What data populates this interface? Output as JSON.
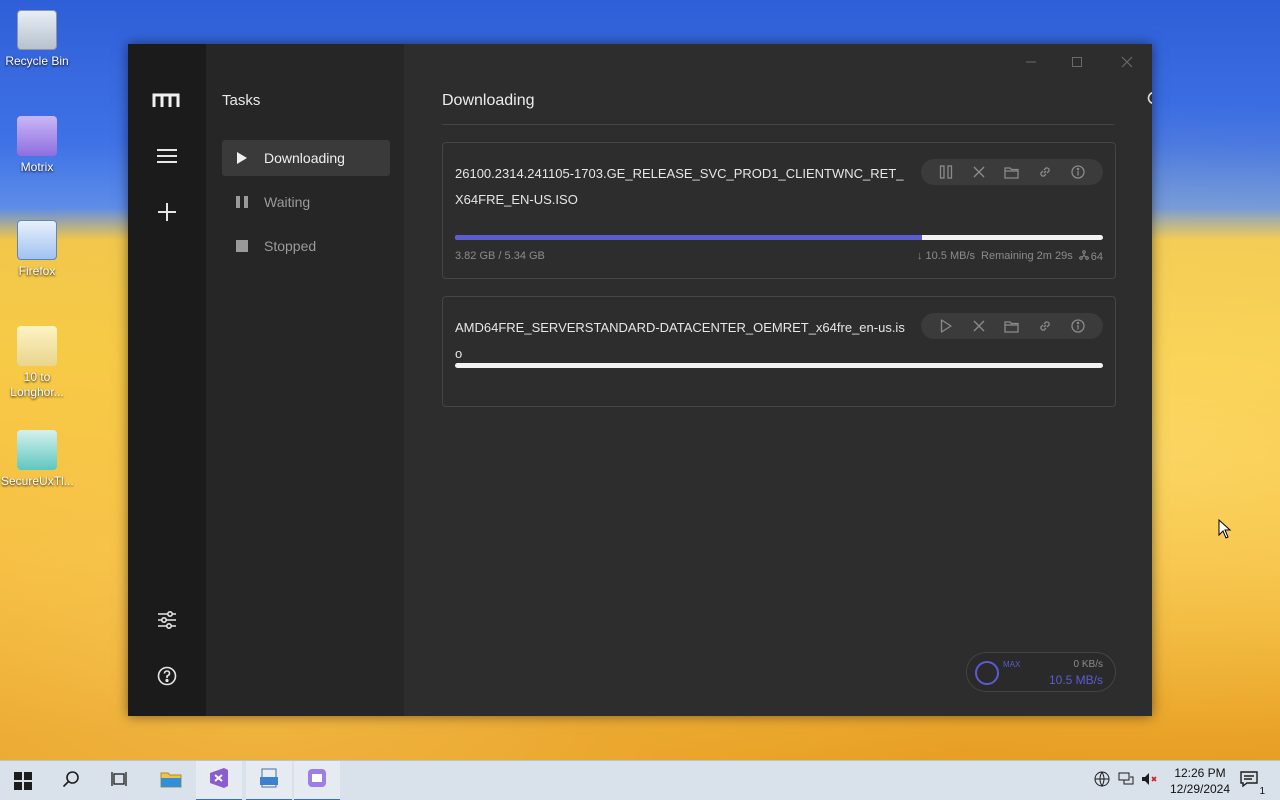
{
  "desktop": {
    "icons": [
      {
        "label": "Recycle Bin"
      },
      {
        "label": "Motrix"
      },
      {
        "label": "Firefox"
      },
      {
        "label": "10 to Longhor..."
      },
      {
        "label": "SecureUxTl..."
      }
    ]
  },
  "window": {
    "sidebar": {
      "logo_icon": "motrix-logo-icon",
      "menu_icon": "menu-icon",
      "add_icon": "plus-icon",
      "preferences_icon": "sliders-icon",
      "help_icon": "help-icon"
    },
    "subnav": {
      "title": "Tasks",
      "items": [
        {
          "label": "Downloading",
          "icon": "play-icon",
          "active": true
        },
        {
          "label": "Waiting",
          "icon": "pause-icon",
          "active": false
        },
        {
          "label": "Stopped",
          "icon": "stop-icon",
          "active": false
        }
      ]
    },
    "main": {
      "title": "Downloading",
      "toolbar": [
        "refresh-icon",
        "resume-all-icon",
        "pause-all-icon"
      ],
      "tasks": [
        {
          "name": "26100.2314.241105-1703.GE_RELEASE_SVC_PROD1_CLIENTWNC_RET_X64FRE_EN-US.ISO",
          "progress": 0.72,
          "size": "3.82 GB / 5.34 GB",
          "speed": "↓ 10.5 MB/s",
          "remaining": "Remaining 2m 29s",
          "connections": "64",
          "actions": [
            "pause-icon",
            "delete-icon",
            "folder-icon",
            "link-icon",
            "info-icon"
          ]
        },
        {
          "name": "AMD64FRE_SERVERSTANDARD-DATACENTER_OEMRET_x64fre_en-us.iso",
          "progress": 0,
          "actions": [
            "play-icon",
            "delete-icon",
            "folder-icon",
            "link-icon",
            "info-icon"
          ]
        }
      ],
      "speedometer": {
        "upload": "0 KB/s",
        "download": "10.5 MB/s",
        "label": "MAX"
      }
    }
  },
  "taskbar": {
    "clock_time": "12:26 PM",
    "clock_date": "12/29/2024",
    "notification_count": "1"
  },
  "colors": {
    "accent": "#5b5bd6"
  }
}
